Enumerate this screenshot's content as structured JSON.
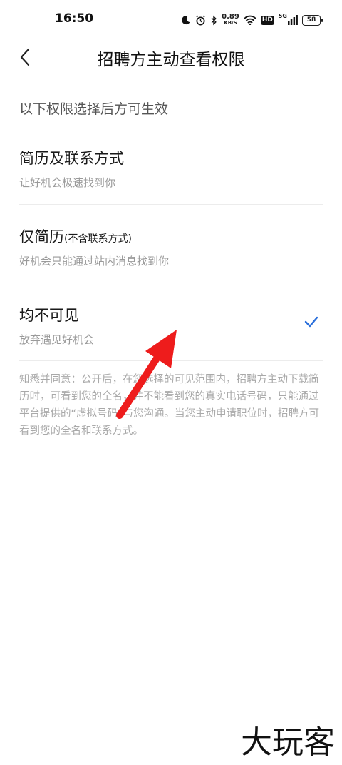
{
  "status_bar": {
    "time": "16:50",
    "net_speed_value": "0.89",
    "net_speed_unit": "KB/S",
    "hd_label": "HD",
    "net_type": "5G",
    "battery": "58"
  },
  "nav": {
    "title": "招聘方主动查看权限"
  },
  "hint": "以下权限选择后方可生效",
  "options": [
    {
      "title": "简历及联系方式",
      "title_suffix": "",
      "desc": "让好机会极速找到你",
      "selected": false
    },
    {
      "title": "仅简历",
      "title_suffix": "(不含联系方式)",
      "desc": "好机会只能通过站内消息找到你",
      "selected": false
    },
    {
      "title": "均不可见",
      "title_suffix": "",
      "desc": "放弃遇见好机会",
      "selected": true
    }
  ],
  "footnote": "知悉并同意：公开后，在您选择的可见范围内，招聘方主动下载简历时，可看到您的全名，并不能看到您的真实电话号码，只能通过平台提供的“虚拟号码”与您沟通。当您主动申请职位时，招聘方可看到您的全名和联系方式。",
  "watermark": "大玩客",
  "colors": {
    "accent": "#2a6fdb",
    "annotation_arrow": "#ee1c1c"
  }
}
